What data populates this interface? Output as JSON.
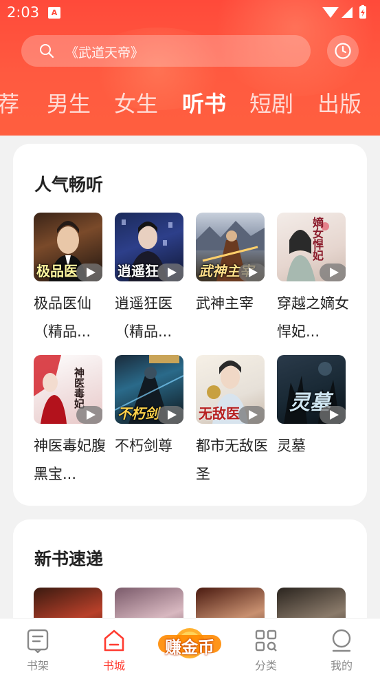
{
  "status": {
    "time": "2:03",
    "notification_glyph": "A"
  },
  "search": {
    "placeholder": "《武道天帝》"
  },
  "tabs": [
    {
      "label": "荐",
      "active": false
    },
    {
      "label": "男生",
      "active": false
    },
    {
      "label": "女生",
      "active": false
    },
    {
      "label": "听书",
      "active": true
    },
    {
      "label": "短剧",
      "active": false
    },
    {
      "label": "出版",
      "active": false
    }
  ],
  "sections": [
    {
      "title": "人气畅听",
      "books": [
        {
          "title": "极品医仙（精品...",
          "cover_text": "极品医"
        },
        {
          "title": "逍遥狂医（精品...",
          "cover_text": "逍遥狂"
        },
        {
          "title": "武神主宰",
          "cover_text": "武神主宰"
        },
        {
          "title": "穿越之嫡女悍妃...",
          "cover_text": "嫡女悍妃"
        },
        {
          "title": "神医毒妃腹黑宝...",
          "cover_text": "神医毒妃"
        },
        {
          "title": "不朽剑尊",
          "cover_text": "不朽剑"
        },
        {
          "title": "都市无敌医圣",
          "cover_text": "无敌医"
        },
        {
          "title": "灵墓",
          "cover_text": "灵墓"
        }
      ]
    },
    {
      "title": "新书速递",
      "books": []
    }
  ],
  "bottom_nav": [
    {
      "label": "书架",
      "icon": "bookshelf-icon",
      "active": false
    },
    {
      "label": "书城",
      "icon": "bookstore-icon",
      "active": true
    },
    {
      "label": "赚金币",
      "icon": "earn-coins-icon",
      "active": false
    },
    {
      "label": "分类",
      "icon": "category-icon",
      "active": false
    },
    {
      "label": "我的",
      "icon": "profile-icon",
      "active": false
    }
  ],
  "colors": {
    "brand": "#ff4a3a",
    "active_nav": "#ff3b30",
    "coin": "#ff8a00"
  }
}
